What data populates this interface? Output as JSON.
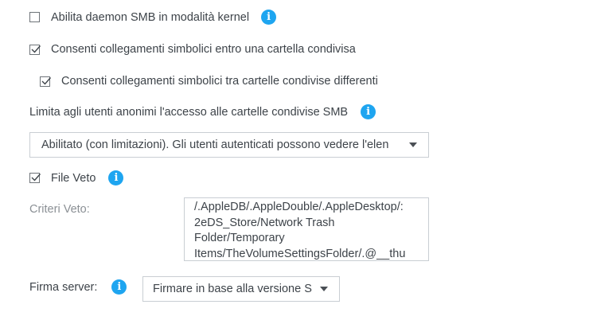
{
  "settings": {
    "smb_kernel": {
      "label": "Abilita daemon SMB in modalità kernel",
      "checked": false
    },
    "symlinks_within": {
      "label": "Consenti collegamenti simbolici entro una cartella condivisa",
      "checked": true
    },
    "symlinks_between": {
      "label": "Consenti collegamenti simbolici tra cartelle condivise differenti",
      "checked": true
    },
    "anon_access": {
      "label": "Limita agli utenti anonimi l'accesso alle cartelle condivise SMB",
      "selected": "Abilitato (con limitazioni). Gli utenti autenticati possono vedere l'elen"
    },
    "file_veto": {
      "label": "File Veto",
      "checked": true
    },
    "veto_criteria": {
      "label": "Criteri Veto:",
      "lines": [
        "/.AppleDB/.AppleDouble/.AppleDesktop/:",
        "2eDS_Store/Network Trash",
        "Folder/Temporary",
        "Items/TheVolumeSettingsFolder/.@__thu"
      ]
    },
    "server_signing": {
      "label": "Firma server:",
      "selected": "Firmare in base alla versione S"
    }
  },
  "icons": {
    "info": "i"
  },
  "colors": {
    "info_accent": "#1ea5f0"
  }
}
